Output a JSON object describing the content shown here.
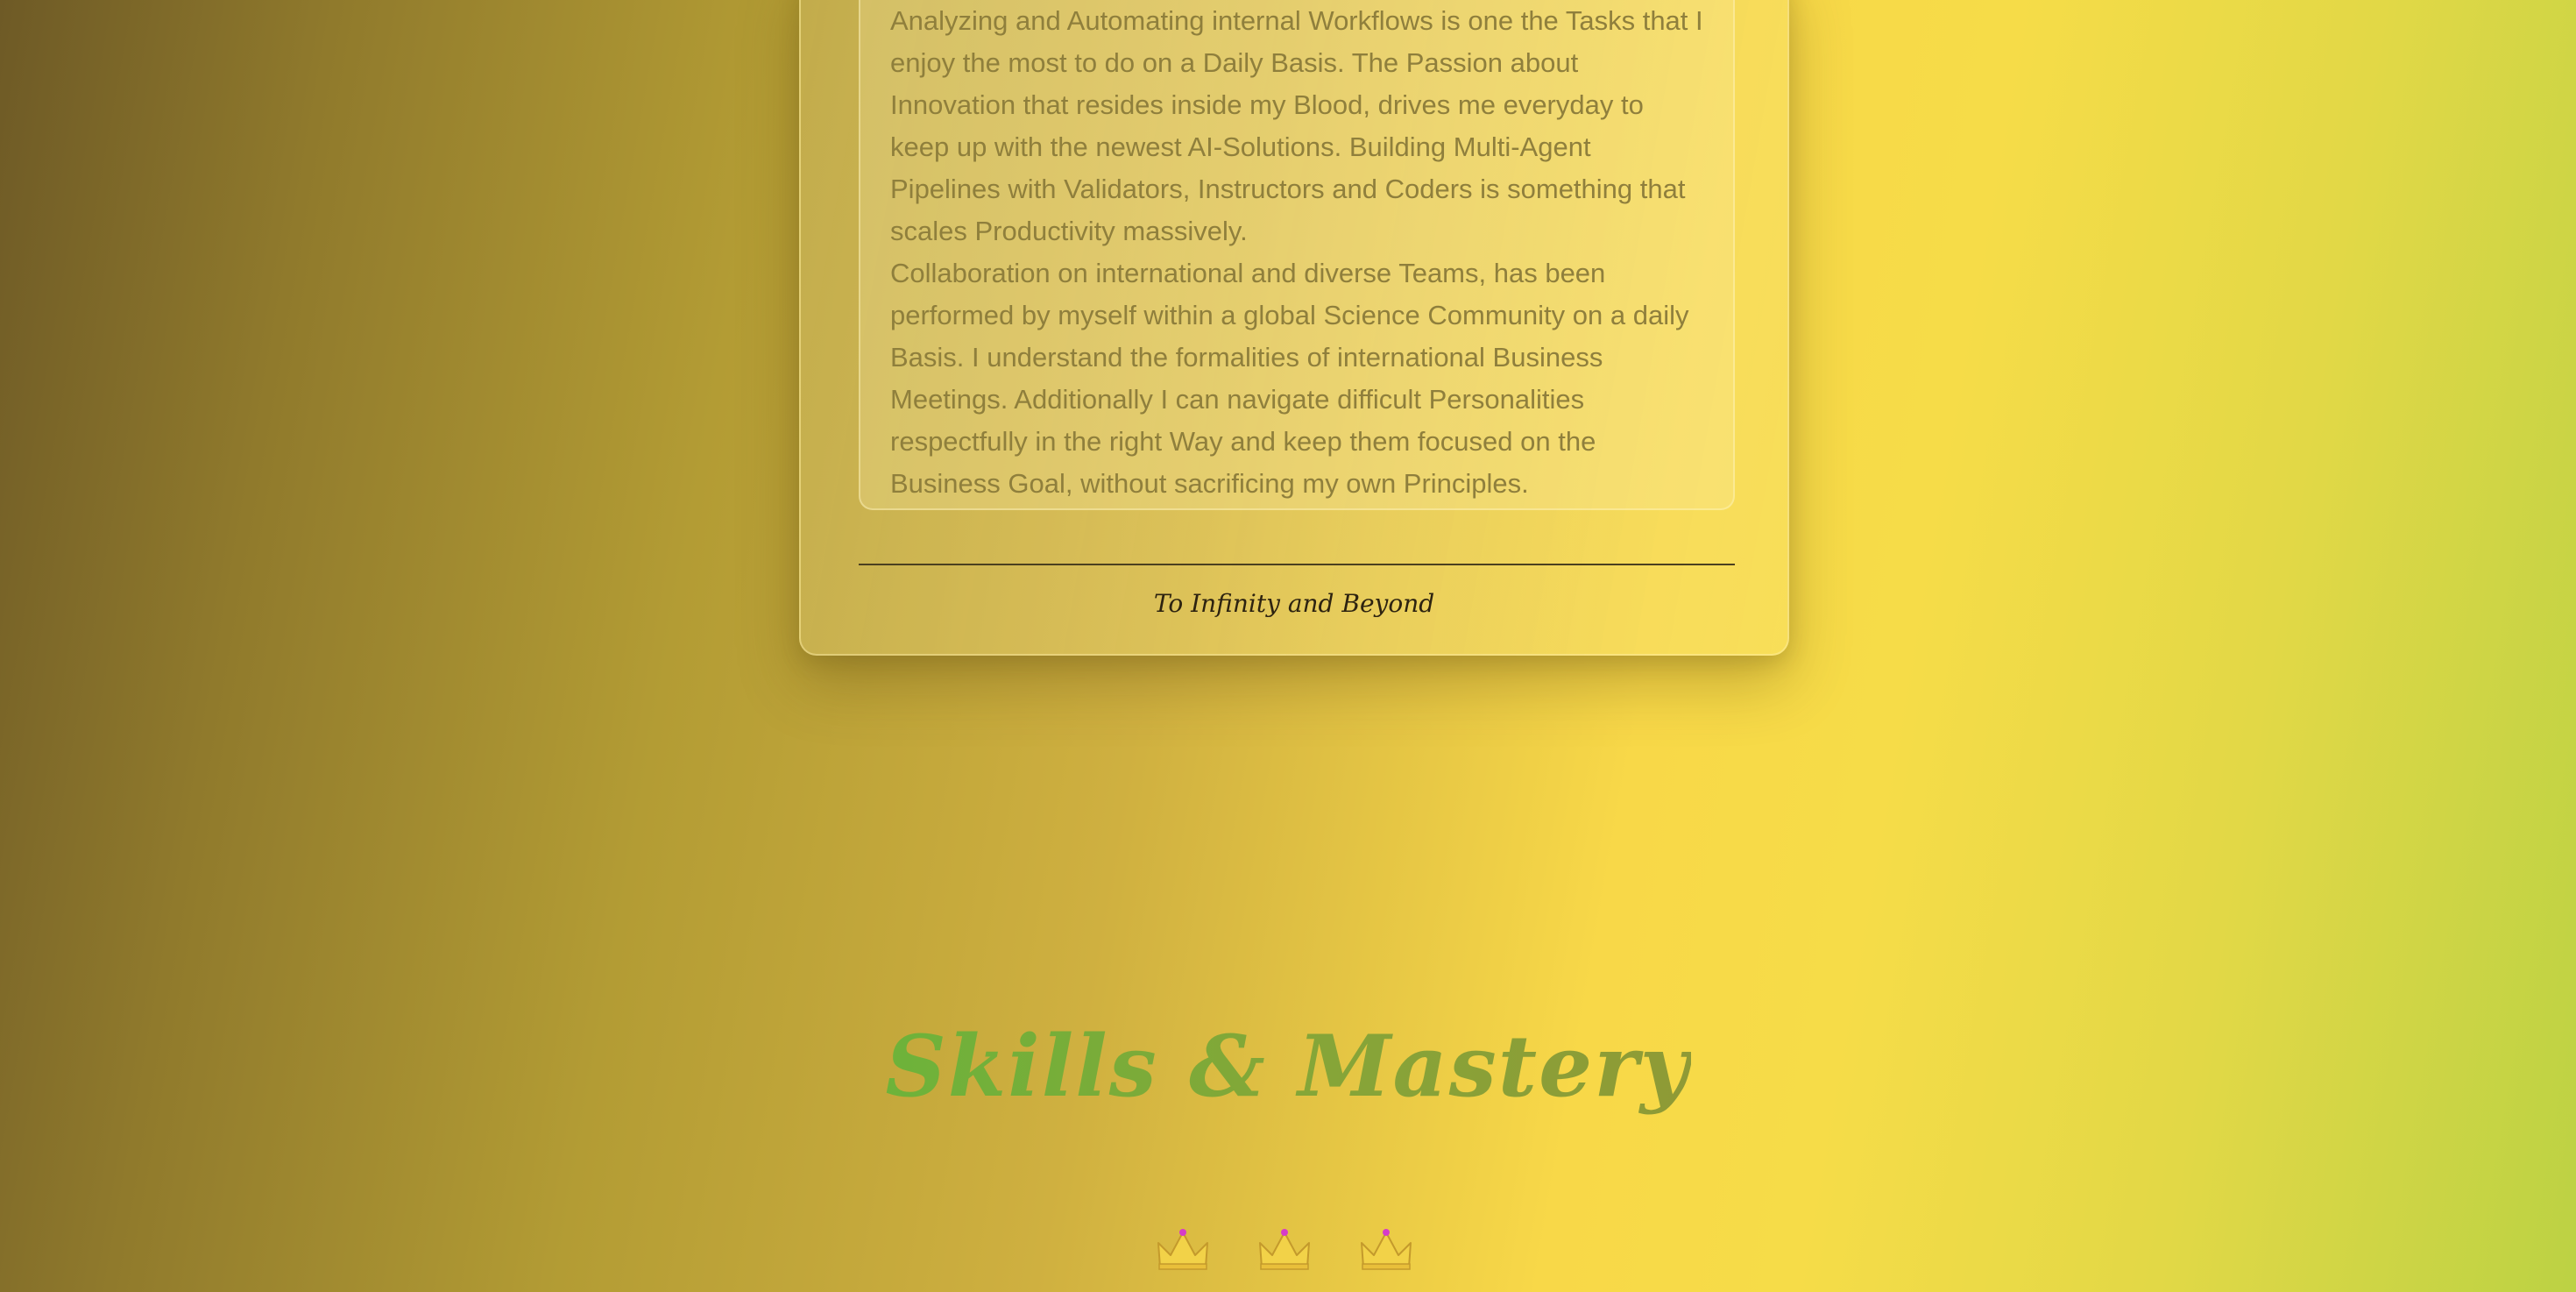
{
  "about": {
    "paragraph_1": "Analyzing and Automating internal Workflows is one the Tasks that I enjoy the most to do on a Daily Basis. The Passion about Innovation that resides inside my Blood, drives me everyday to keep up with the newest AI-Solutions. Building Multi-Agent Pipelines with Validators, Instructors and Coders is something that scales Productivity massively.",
    "paragraph_2": "Collaboration on international and diverse Teams, has been performed by myself within a global Science Community on a daily Basis. I understand the formalities of international Business Meetings. Additionally I can navigate difficult Personalities respectfully in the right Way and keep them focused on the Business Goal, without sacrificing my own Principles.",
    "motto": "To Infinity and Beyond"
  },
  "skills": {
    "title": "Skills & Mastery",
    "icons": [
      "crown-icon",
      "crown-icon",
      "crown-icon"
    ]
  },
  "colors": {
    "body_text": "#8f7f3c",
    "title_green": "#7aa838",
    "motto_text": "#2d2310",
    "crown_gold": "#f2d248",
    "crown_gem": "#d63cc8"
  }
}
